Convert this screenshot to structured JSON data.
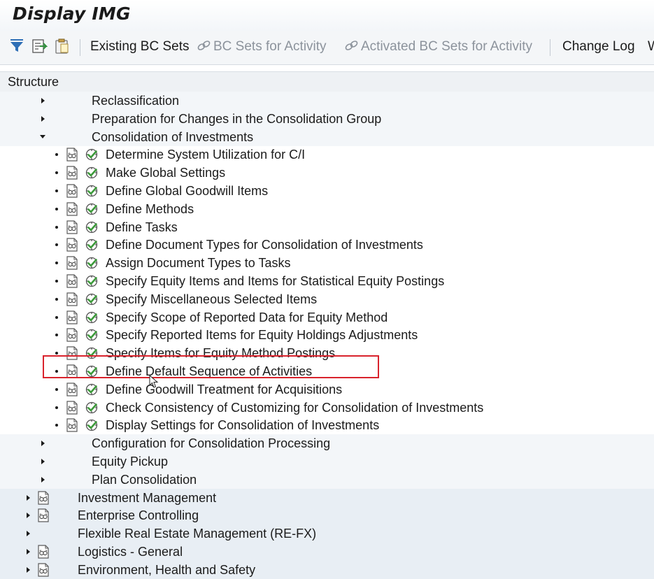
{
  "window": {
    "title": "Display IMG"
  },
  "toolbar": {
    "icons": [
      "filter-icon",
      "bc-set-transport-icon",
      "clipboard-icon"
    ],
    "buttons": {
      "existing_bc_sets": "Existing BC Sets",
      "bc_sets_for_activity": "BC Sets for Activity",
      "activated_bc_sets_for_activity": "Activated BC Sets for Activity",
      "change_log": "Change Log",
      "overflow": "W"
    }
  },
  "structure": {
    "header": "Structure",
    "rows": [
      {
        "label": "Reclassification",
        "node": "folder",
        "expanded": false,
        "level": 3
      },
      {
        "label": "Preparation for Changes in the Consolidation Group",
        "node": "folder",
        "expanded": false,
        "level": 3
      },
      {
        "label": "Consolidation of Investments",
        "node": "folder",
        "expanded": true,
        "level": 3
      },
      {
        "label": "Determine System Utilization for C/I",
        "node": "activity",
        "level": 4
      },
      {
        "label": "Make Global Settings",
        "node": "activity",
        "level": 4
      },
      {
        "label": "Define Global Goodwill Items",
        "node": "activity",
        "level": 4
      },
      {
        "label": "Define Methods",
        "node": "activity",
        "level": 4
      },
      {
        "label": "Define Tasks",
        "node": "activity",
        "level": 4
      },
      {
        "label": "Define Document Types for Consolidation of Investments",
        "node": "activity",
        "level": 4
      },
      {
        "label": "Assign Document Types to Tasks",
        "node": "activity",
        "level": 4
      },
      {
        "label": "Specify Equity Items and Items for Statistical Equity Postings",
        "node": "activity",
        "level": 4
      },
      {
        "label": "Specify Miscellaneous Selected Items",
        "node": "activity",
        "level": 4
      },
      {
        "label": "Specify Scope of Reported Data for Equity Method",
        "node": "activity",
        "level": 4
      },
      {
        "label": "Specify Reported Items for Equity Holdings Adjustments",
        "node": "activity",
        "level": 4
      },
      {
        "label": "Specify Items for Equity Method Postings",
        "node": "activity",
        "level": 4
      },
      {
        "label": "Define Default Sequence of Activities",
        "node": "activity",
        "level": 4,
        "highlighted": true
      },
      {
        "label": "Define Goodwill Treatment for Acquisitions",
        "node": "activity",
        "level": 4
      },
      {
        "label": "Check Consistency of Customizing for Consolidation of Investments",
        "node": "activity",
        "level": 4
      },
      {
        "label": "Display Settings for Consolidation of Investments",
        "node": "activity",
        "level": 4
      },
      {
        "label": "Configuration for Consolidation Processing",
        "node": "folder",
        "expanded": false,
        "level": 3
      },
      {
        "label": "Equity Pickup",
        "node": "folder",
        "expanded": false,
        "level": 3
      },
      {
        "label": "Plan Consolidation",
        "node": "folder",
        "expanded": false,
        "level": 3
      },
      {
        "label": "Investment Management",
        "node": "folder-doc",
        "expanded": false,
        "level": 2
      },
      {
        "label": "Enterprise Controlling",
        "node": "folder-doc",
        "expanded": false,
        "level": 2
      },
      {
        "label": "Flexible Real Estate Management (RE-FX)",
        "node": "folder",
        "expanded": false,
        "level": 2
      },
      {
        "label": "Logistics - General",
        "node": "folder-doc",
        "expanded": false,
        "level": 2
      },
      {
        "label": "Environment, Health and Safety",
        "node": "folder-doc",
        "expanded": false,
        "level": 2
      }
    ]
  },
  "colors": {
    "highlight_border": "#d9232d",
    "execute_icon_green": "#3c9a3a",
    "band_background": "#e8eef4"
  }
}
